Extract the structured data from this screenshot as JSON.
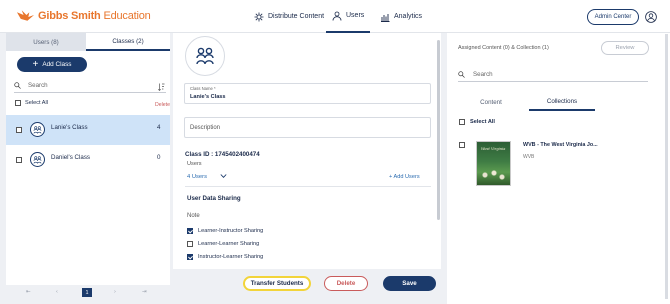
{
  "header": {
    "logo_text_bold": "Gibbs Smith",
    "logo_text_light": " Education",
    "nav": [
      {
        "label": "Distribute Content",
        "icon": "distribute-icon"
      },
      {
        "label": "Users",
        "icon": "users-icon"
      },
      {
        "label": "Analytics",
        "icon": "analytics-icon"
      }
    ],
    "admin_button": "Admin Center",
    "user_icon": "user-circle-icon"
  },
  "left": {
    "tab_users": "Users (8)",
    "tab_classes": "Classes (2)",
    "add_class": "Add Class",
    "search_placeholder": "Search",
    "select_all": "Select All",
    "delete": "Delete",
    "classes": [
      {
        "name": "Lanie's Class",
        "count": "4"
      },
      {
        "name": "Daniel's Class",
        "count": "0"
      }
    ],
    "pagination": {
      "first": "⇤",
      "prev": "‹",
      "current": "1",
      "next": "›",
      "last": "⇥"
    }
  },
  "middle": {
    "name_label": "Class Name *",
    "name_value": "Lanie's Class",
    "description_placeholder": "Description",
    "class_id": "Class ID : 1745402400474",
    "users_label": "Users",
    "users_count": "4 Users",
    "add_users": "+ Add Users",
    "user_data_sharing": "User Data Sharing",
    "note": "Note",
    "sharing": [
      {
        "label": "Learner-Instructor Sharing",
        "checked": true
      },
      {
        "label": "Learner-Learner Sharing",
        "checked": false
      },
      {
        "label": "Instructor-Learner Sharing",
        "checked": true
      }
    ]
  },
  "buttons": {
    "transfer": "Transfer Students",
    "delete": "Delete",
    "save": "Save"
  },
  "right": {
    "assigned": "Assigned Content (0) & Collection (1)",
    "review": "Review",
    "search_placeholder": "Search",
    "tab_content": "Content",
    "tab_collections": "Collections",
    "select_all": "Select All",
    "collection": {
      "title": "WVB - The West Virginia Jo...",
      "subtitle": "WVB",
      "cover_text": "West Virginia"
    }
  },
  "colors": {
    "brand_orange": "#e8762d",
    "navy": "#1b3a6b",
    "selected_row": "#cfe3f8",
    "danger": "#c95b5b",
    "highlight": "#f2d43a"
  }
}
